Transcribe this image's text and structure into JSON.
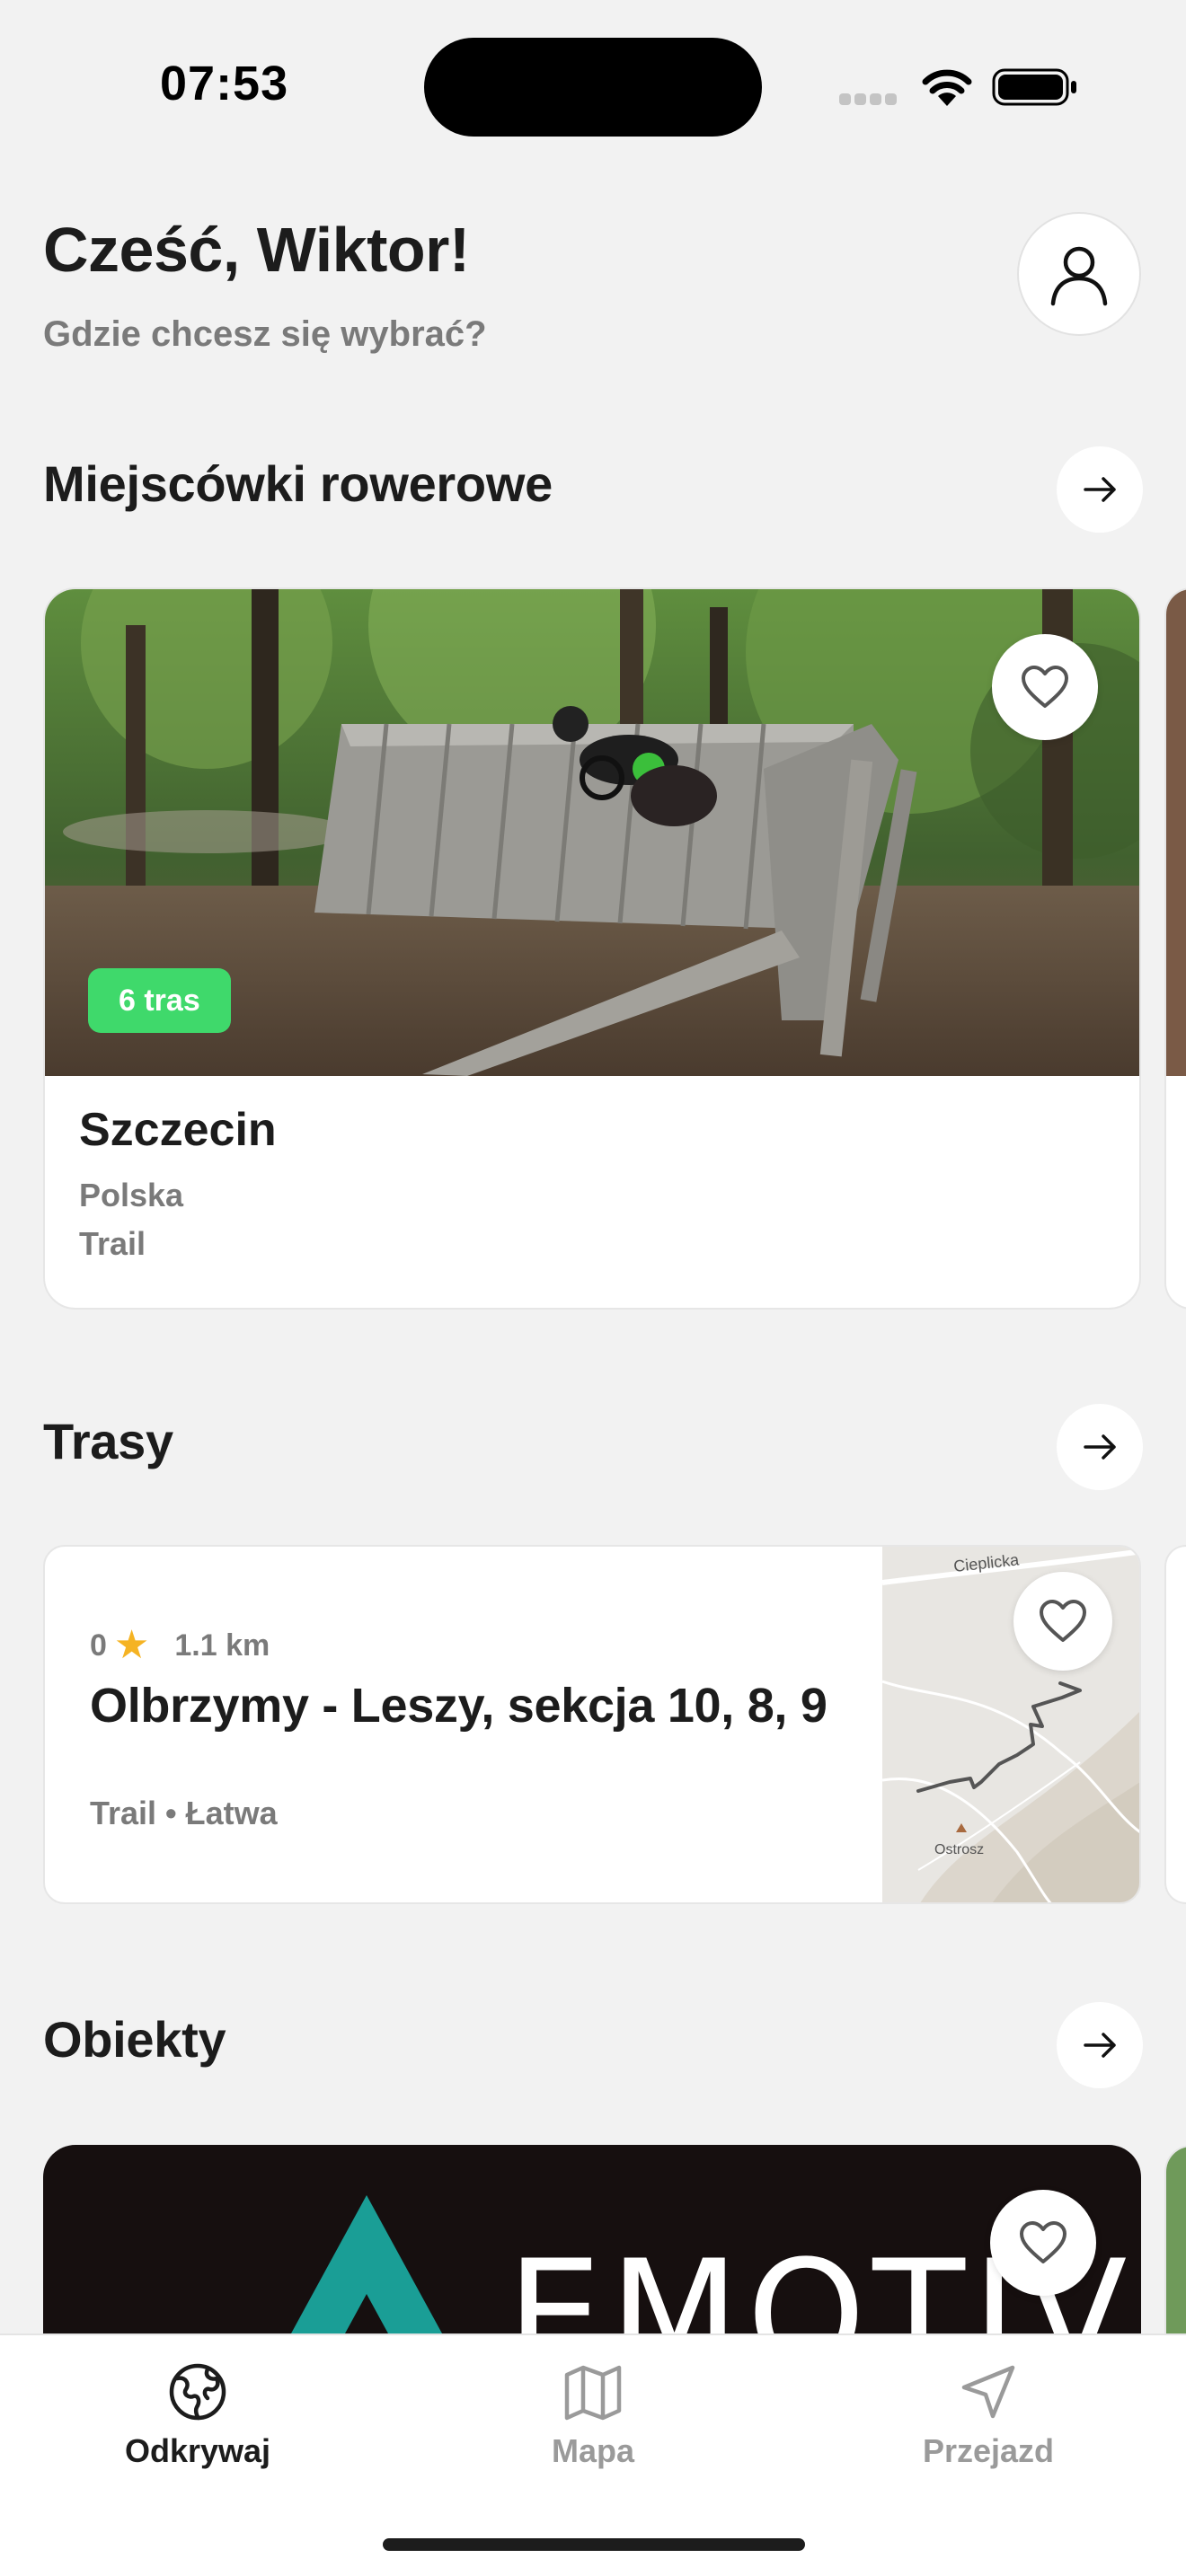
{
  "status_bar": {
    "time": "07:53"
  },
  "header": {
    "greeting": "Cześć, Wiktor!",
    "subtitle": "Gdzie chcesz się wybrać?"
  },
  "sections": {
    "spots": {
      "title": "Miejscówki rowerowe",
      "card": {
        "badge": "6 tras",
        "name": "Szczecin",
        "country": "Polska",
        "type": "Trail"
      }
    },
    "routes": {
      "title": "Trasy",
      "card": {
        "rating": "0",
        "distance": "1.1 km",
        "name": "Olbrzymy - Leszy, sekcja 10, 8, 9",
        "tags": "Trail • Łatwa",
        "map_labels": {
          "top": "Cieplicka",
          "bottom": "Ostrosz"
        }
      }
    },
    "objects": {
      "title": "Obiekty",
      "card": {
        "logo_text": "EMOTIV"
      }
    }
  },
  "tab_bar": {
    "tabs": [
      {
        "label": "Odkrywaj",
        "icon": "globe-icon",
        "active": true
      },
      {
        "label": "Mapa",
        "icon": "map-icon",
        "active": false
      },
      {
        "label": "Przejazd",
        "icon": "navigation-arrow-icon",
        "active": false
      }
    ]
  },
  "colors": {
    "background": "#f2f2f2",
    "badge_green": "#3fd96b",
    "star_yellow": "#f5b323",
    "active_tab": "#1c1c1c",
    "inactive_tab": "#9a9a9a",
    "emotiv_teal": "#1a9e96"
  }
}
